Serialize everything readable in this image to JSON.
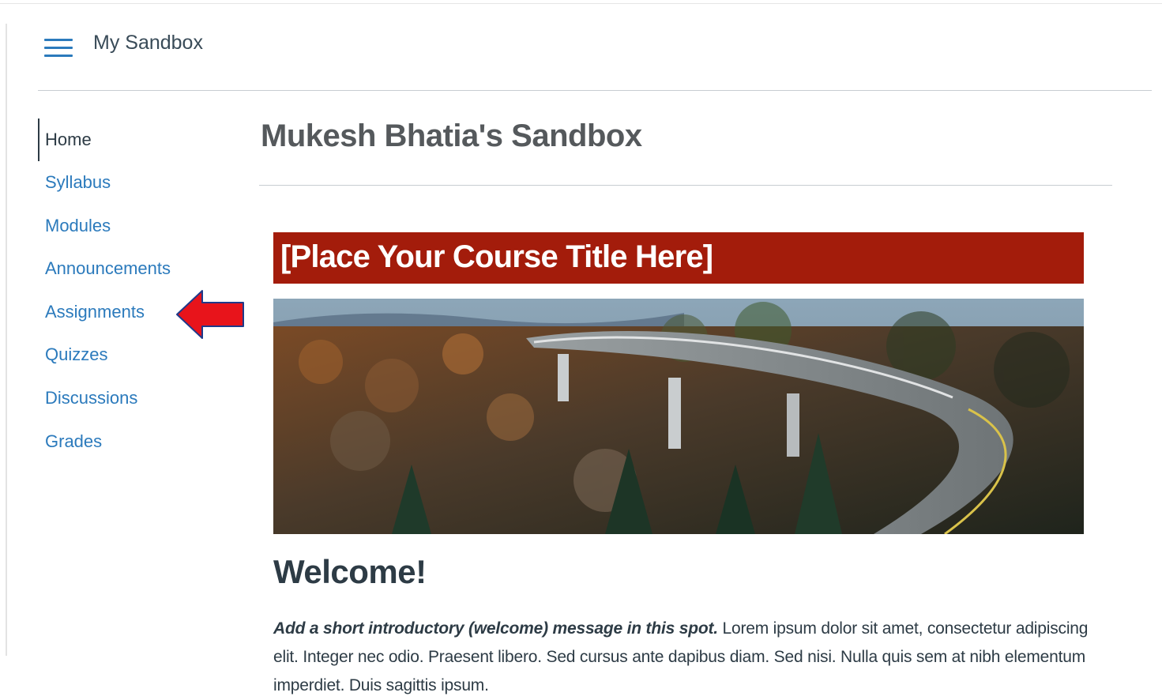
{
  "header": {
    "menu_icon": "hamburger-menu-icon",
    "breadcrumb": "My Sandbox"
  },
  "nav": {
    "items": [
      {
        "label": "Home",
        "active": true
      },
      {
        "label": "Syllabus"
      },
      {
        "label": "Modules"
      },
      {
        "label": "Announcements"
      },
      {
        "label": "Assignments"
      },
      {
        "label": "Quizzes"
      },
      {
        "label": "Discussions"
      },
      {
        "label": "Grades"
      }
    ]
  },
  "annotation": {
    "icon": "red-arrow-left-icon",
    "color": "#e8141b",
    "points_to": "Assignments"
  },
  "main": {
    "page_title": "Mukesh Bhatia's Sandbox",
    "banner_title": "[Place Your Course Title Here]",
    "banner_color": "#a31c0b",
    "welcome_heading": "Welcome!",
    "intro_bold": "Add a short introductory (welcome) message in this spot.",
    "intro_text": " Lorem ipsum dolor sit amet, consectetur adipiscing elit. Integer nec odio. Praesent libero. Sed cursus ante dapibus diam. Sed nisi. Nulla quis sem at nibh elementum imperdiet. Duis sagittis ipsum."
  },
  "colors": {
    "link": "#2b7abc",
    "text": "#2d3b45"
  }
}
